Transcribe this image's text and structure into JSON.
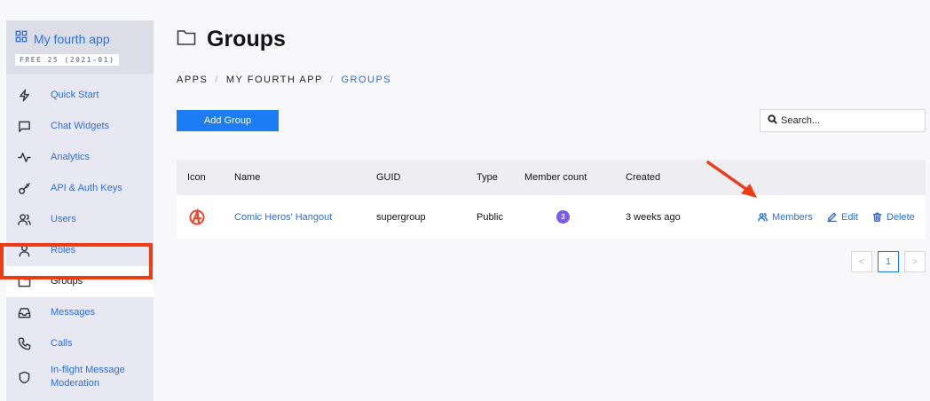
{
  "sidebar": {
    "app_name": "My fourth app",
    "plan": "FREE 25 (2021-01)",
    "items": [
      {
        "label": "Quick Start",
        "icon": "lightning-icon"
      },
      {
        "label": "Chat Widgets",
        "icon": "chat-bubble-icon"
      },
      {
        "label": "Analytics",
        "icon": "activity-icon"
      },
      {
        "label": "API & Auth Keys",
        "icon": "key-icon"
      },
      {
        "label": "Users",
        "icon": "users-icon"
      },
      {
        "label": "Roles",
        "icon": "user-icon"
      },
      {
        "label": "Groups",
        "icon": "folder-icon"
      },
      {
        "label": "Messages",
        "icon": "inbox-icon"
      },
      {
        "label": "Calls",
        "icon": "phone-icon"
      },
      {
        "label": "In-flight Message Moderation",
        "icon": "shield-icon"
      }
    ],
    "active": "Groups"
  },
  "header": {
    "title": "Groups"
  },
  "breadcrumb": [
    "APPS",
    "MY FOURTH APP",
    "GROUPS"
  ],
  "toolbar": {
    "add_label": "Add Group",
    "search_placeholder": "Search..."
  },
  "table": {
    "columns": [
      "Icon",
      "Name",
      "GUID",
      "Type",
      "Member count",
      "Created"
    ],
    "rows": [
      {
        "name": "Comic Heros' Hangout",
        "guid": "supergroup",
        "type": "Public",
        "member_count": "3",
        "created": "3 weeks ago",
        "actions": {
          "members": "Members",
          "edit": "Edit",
          "delete": "Delete"
        }
      }
    ]
  },
  "pagination": {
    "prev": "<",
    "current": "1",
    "next": ">"
  },
  "colors": {
    "accent": "#1b7cf3",
    "link": "#2c6fe0",
    "highlight": "#f03a14",
    "badge": "#7b5ce6"
  }
}
